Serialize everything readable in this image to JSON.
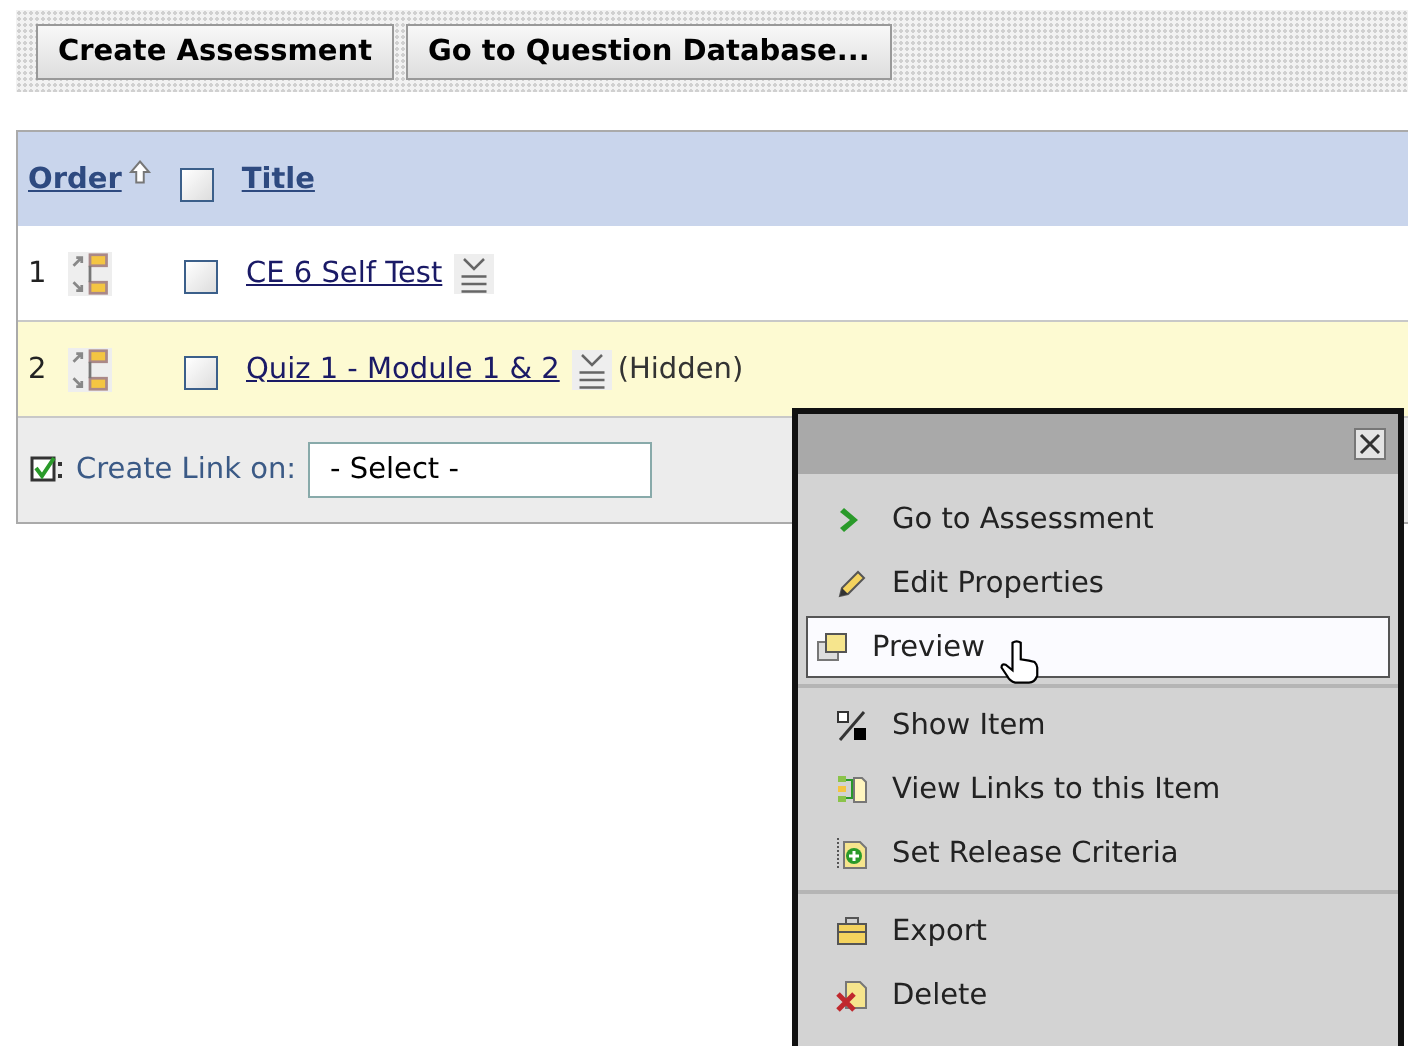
{
  "toolbar": {
    "buttons": [
      "Create Assessment",
      "Go to Question Database..."
    ]
  },
  "table": {
    "columns": [
      {
        "label": "Order",
        "sorted": true
      },
      {
        "label": "Title",
        "checkbox_checked": false
      }
    ],
    "rows": [
      {
        "order": "1",
        "title": "CE 6 Self Test",
        "selected": false,
        "checked": false
      },
      {
        "order": "2",
        "title": "Quiz 1 - Module 1 & 2",
        "note": "(Hidden)",
        "selected": true,
        "checked": false
      }
    ],
    "footer": {
      "label": "Create Link on:",
      "select": "- Select -"
    }
  },
  "context_menu": {
    "groups": [
      [
        {
          "label": "Go to Assessment",
          "selected": false
        },
        {
          "label": "Edit Properties",
          "selected": false
        },
        {
          "label": "Preview",
          "selected": true
        }
      ],
      [
        {
          "label": "Show Item",
          "selected": false
        },
        {
          "label": "View Links to this Item",
          "selected": false
        },
        {
          "label": "Set Release Criteria",
          "selected": false
        }
      ],
      [
        {
          "label": "Export",
          "selected": false
        },
        {
          "label": "Delete",
          "selected": false
        }
      ]
    ]
  }
}
